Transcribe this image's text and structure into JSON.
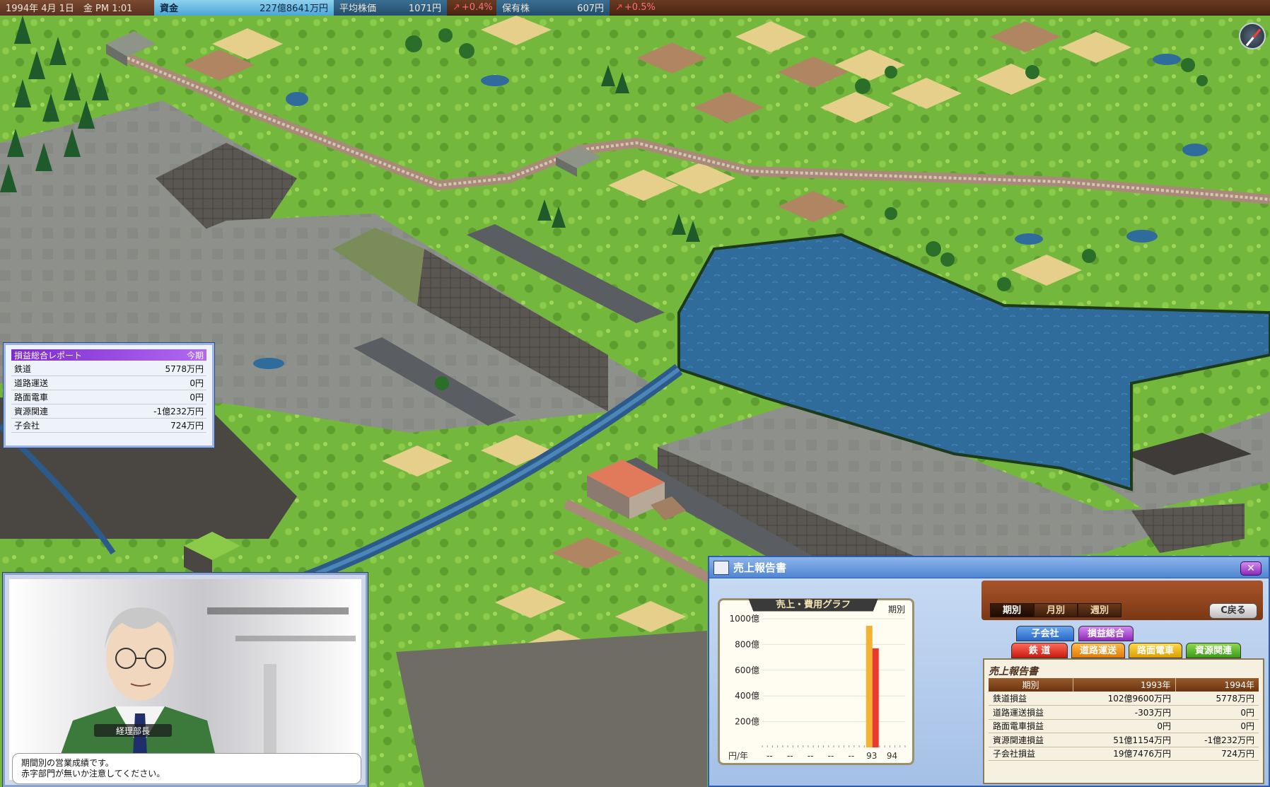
{
  "topbar": {
    "date": "1994年 4月 1日　金 PM 1:01",
    "funds_label": "資金",
    "funds_value": "227億8641万円",
    "avg_stock_label": "平均株価",
    "avg_stock_value": "1071円",
    "avg_stock_change": "+0.4%",
    "held_stock_label": "保有株",
    "held_stock_value": "607円",
    "held_stock_change": "+0.5%"
  },
  "pl_panel": {
    "title": "損益総合レポート",
    "period": "今期",
    "rows": [
      {
        "label": "鉄道",
        "value": "5778万円"
      },
      {
        "label": "道路運送",
        "value": "0円"
      },
      {
        "label": "路面電車",
        "value": "0円"
      },
      {
        "label": "資源関連",
        "value": "-1億232万円"
      },
      {
        "label": "子会社",
        "value": "724万円"
      }
    ]
  },
  "advisor": {
    "name": "経理部長",
    "message_line1": "期間別の営業成績です。",
    "message_line2": "赤字部門が無いか注意してください。"
  },
  "sales_window": {
    "title": "売上報告書",
    "close_label": "✕",
    "period_tabs": [
      "期別",
      "月別",
      "週別"
    ],
    "back_label": "C戻る",
    "category_tabs": {
      "subsidiary": "子会社",
      "pl_total": "損益総合",
      "rail": "鉄 道",
      "road": "道路運送",
      "tram": "路面電車",
      "resource": "資源関連"
    },
    "report_title": "売上報告書",
    "table": {
      "headers": [
        "期別",
        "1993年",
        "1994年"
      ],
      "rows": [
        [
          "鉄道損益",
          "102億9600万円",
          "5778万円"
        ],
        [
          "道路運送損益",
          "-303万円",
          "0円"
        ],
        [
          "路面電車損益",
          "0円",
          "0円"
        ],
        [
          "資源関連損益",
          "51億1154万円",
          "-1億232万円"
        ],
        [
          "子会社損益",
          "19億7476万円",
          "724万円"
        ]
      ]
    }
  },
  "chart_data": {
    "type": "bar",
    "title": "売上・費用グラフ",
    "period_label": "期別",
    "unit_label": "円/年",
    "y_ticks": [
      "1000億",
      "800億",
      "600億",
      "400億",
      "200億"
    ],
    "y_tick_values": [
      1000,
      800,
      600,
      400,
      200
    ],
    "ylim": [
      0,
      1000
    ],
    "categories": [
      "--",
      "--",
      "--",
      "--",
      "--",
      "93",
      "94"
    ],
    "series": [
      {
        "values": [
          0,
          0,
          0,
          0,
          0,
          945,
          0
        ],
        "color": "#f2b233"
      },
      {
        "values": [
          0,
          0,
          0,
          0,
          0,
          770,
          0
        ],
        "color": "#e83a2e"
      }
    ]
  },
  "colors": {
    "grass": "#6fb43a",
    "water": "#2f6e9e",
    "concrete": "#8c8f8a",
    "cliff": "#55524e"
  }
}
